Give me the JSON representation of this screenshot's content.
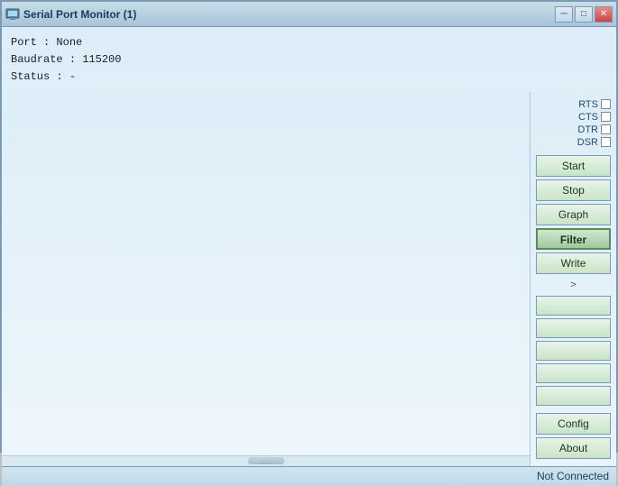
{
  "window": {
    "title": "Serial Port Monitor (1)",
    "minimize_label": "─",
    "maximize_label": "□",
    "close_label": "✕"
  },
  "info": {
    "port_label": "Port",
    "port_value": "None",
    "baudrate_label": "Baudrate",
    "baudrate_value": "115200",
    "status_label": "Status",
    "status_value": "-"
  },
  "signals": [
    {
      "name": "RTS"
    },
    {
      "name": "CTS"
    },
    {
      "name": "DTR"
    },
    {
      "name": "DSR"
    }
  ],
  "buttons": {
    "start": "Start",
    "stop": "Stop",
    "graph": "Graph",
    "filter": "Filter",
    "write": "Write",
    "config": "Config",
    "about": "About"
  },
  "arrow": ">",
  "status_bar": {
    "text": "Not Connected"
  },
  "scrollbar": {
    "indicator": "......."
  },
  "extra_buttons": [
    "",
    "",
    "",
    "",
    ""
  ]
}
